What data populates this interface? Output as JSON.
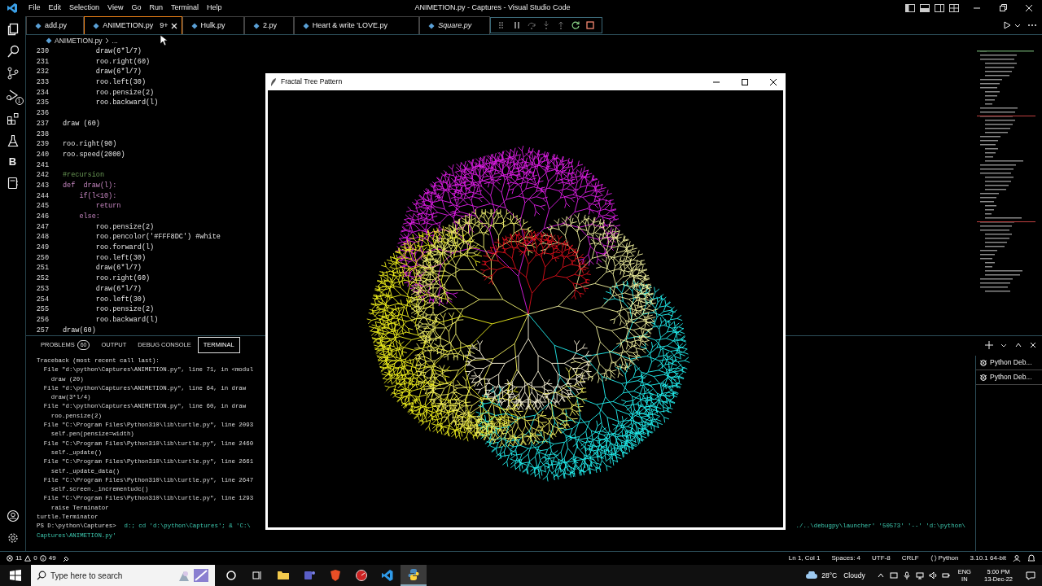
{
  "window": {
    "title": "ANIMETION.py - Captures - Visual Studio Code"
  },
  "menu": [
    "File",
    "Edit",
    "Selection",
    "View",
    "Go",
    "Run",
    "Terminal",
    "Help"
  ],
  "activity_bar": {
    "debug_badge": "1",
    "letter_item": "B"
  },
  "tabs": [
    {
      "label": "add.py",
      "selected": false,
      "preview": false
    },
    {
      "label": "ANIMETION.py",
      "selected": true,
      "preview": false,
      "problems": "9+"
    },
    {
      "label": "Hulk.py",
      "selected": false,
      "preview": false
    },
    {
      "label": "2.py",
      "selected": false,
      "preview": false
    },
    {
      "label": "Heart & write 'LOVE.py",
      "selected": false,
      "preview": false
    },
    {
      "label": "Square.py",
      "selected": false,
      "preview": true
    }
  ],
  "debug_toolbar": [
    {
      "kind": "grip",
      "disabled": false
    },
    {
      "kind": "pause",
      "disabled": false
    },
    {
      "kind": "step-over",
      "disabled": true
    },
    {
      "kind": "step-into",
      "disabled": true
    },
    {
      "kind": "step-out",
      "disabled": true
    },
    {
      "kind": "restart",
      "disabled": false
    },
    {
      "kind": "stop",
      "disabled": false
    }
  ],
  "breadcrumb": [
    "ANIMETION.py",
    "..."
  ],
  "code_lines": [
    {
      "number": "230",
      "kind": "code",
      "text": "        draw(6*l/7)"
    },
    {
      "number": "231",
      "kind": "code",
      "text": "        roo.right(60)"
    },
    {
      "number": "232",
      "kind": "code",
      "text": "        draw(6*l/7)"
    },
    {
      "number": "233",
      "kind": "code",
      "text": "        roo.left(30)"
    },
    {
      "number": "234",
      "kind": "code",
      "text": "        roo.pensize(2)"
    },
    {
      "number": "235",
      "kind": "code",
      "text": "        roo.backward(l)"
    },
    {
      "number": "236",
      "kind": "blank"
    },
    {
      "number": "237",
      "kind": "code",
      "text": "draw (60)"
    },
    {
      "number": "238",
      "kind": "blank"
    },
    {
      "number": "239",
      "kind": "code",
      "text": "roo.right(90)"
    },
    {
      "number": "240",
      "kind": "code",
      "text": "roo.speed(2000)"
    },
    {
      "number": "241",
      "kind": "blank"
    },
    {
      "number": "242",
      "kind": "comment",
      "text": "#recursion"
    },
    {
      "number": "243",
      "kind": "keyword",
      "text": "def  draw(l):"
    },
    {
      "number": "244",
      "kind": "keyword",
      "text": "    if(l<10):"
    },
    {
      "number": "245",
      "kind": "keyword",
      "text": "        return"
    },
    {
      "number": "246",
      "kind": "keyword",
      "text": "    else:"
    },
    {
      "number": "247",
      "kind": "code",
      "text": "        roo.pensize(2)"
    },
    {
      "number": "248",
      "kind": "code",
      "text": "        roo.pencolor('#FFF8DC') #white"
    },
    {
      "number": "249",
      "kind": "code",
      "text": "        roo.forward(l)"
    },
    {
      "number": "250",
      "kind": "code",
      "text": "        roo.left(30)"
    },
    {
      "number": "251",
      "kind": "code",
      "text": "        draw(6*l/7)"
    },
    {
      "number": "252",
      "kind": "code",
      "text": "        roo.right(60)"
    },
    {
      "number": "253",
      "kind": "code",
      "text": "        draw(6*l/7)"
    },
    {
      "number": "254",
      "kind": "code",
      "text": "        roo.left(30)"
    },
    {
      "number": "255",
      "kind": "code",
      "text": "        roo.pensize(2)"
    },
    {
      "number": "256",
      "kind": "code",
      "text": "        roo.backward(l)"
    },
    {
      "number": "257",
      "kind": "code",
      "text": "draw(60)"
    }
  ],
  "panel_tabs": [
    {
      "label": "PROBLEMS",
      "badge": "60",
      "selected": false
    },
    {
      "label": "OUTPUT",
      "selected": false
    },
    {
      "label": "DEBUG CONSOLE",
      "selected": false
    },
    {
      "label": "TERMINAL",
      "selected": true
    }
  ],
  "terminal_lines": [
    {
      "kind": "output",
      "text": "Traceback (most recent call last):"
    },
    {
      "kind": "output",
      "text": "  File \"d:\\python\\Captures\\ANIMETION.py\", line 71, in <modul"
    },
    {
      "kind": "output",
      "text": "    draw (20)"
    },
    {
      "kind": "output",
      "text": "  File \"d:\\python\\Captures\\ANIMETION.py\", line 64, in draw"
    },
    {
      "kind": "output",
      "text": "    draw(3*l/4)"
    },
    {
      "kind": "output",
      "text": "  File \"d:\\python\\Captures\\ANIMETION.py\", line 60, in draw"
    },
    {
      "kind": "output",
      "text": "    roo.pensize(2)"
    },
    {
      "kind": "output",
      "text": "  File \"C:\\Program Files\\Python310\\lib\\turtle.py\", line 2093"
    },
    {
      "kind": "output",
      "text": "    self.pen(pensize=width)"
    },
    {
      "kind": "output",
      "text": "  File \"C:\\Program Files\\Python310\\lib\\turtle.py\", line 2460"
    },
    {
      "kind": "output",
      "text": "    self._update()"
    },
    {
      "kind": "output",
      "text": "  File \"C:\\Program Files\\Python310\\lib\\turtle.py\", line 2661"
    },
    {
      "kind": "output",
      "text": "    self._update_data()"
    },
    {
      "kind": "output",
      "text": "  File \"C:\\Program Files\\Python310\\lib\\turtle.py\", line 2647"
    },
    {
      "kind": "output",
      "text": "    self.screen._incrementudc()"
    },
    {
      "kind": "output",
      "text": "  File \"C:\\Program Files\\Python310\\lib\\turtle.py\", line 1293"
    },
    {
      "kind": "output",
      "text": "    raise Terminator"
    },
    {
      "kind": "output",
      "text": "turtle.Terminator"
    },
    {
      "kind": "prompt",
      "prompt": "PS D:\\python\\Captures>",
      "text": "d:; cd 'd:\\python\\Captures'; & 'C:\\",
      "continuation": "./..\\debugpy\\launcher' '50573' '--' 'd:\\python\\"
    },
    {
      "kind": "command",
      "text": "Captures\\ANIMETION.py'"
    }
  ],
  "terminal_sessions": [
    {
      "label": "Python Deb..."
    },
    {
      "label": "Python Deb..."
    }
  ],
  "status_bar": {
    "errors": "11",
    "warnings": "0",
    "infos": "49",
    "right": [
      "Ln 1, Col 1",
      "Spaces: 4",
      "UTF-8",
      "CRLF",
      "Python",
      "3.10.1 64-bit"
    ]
  },
  "turtle_window": {
    "title": "Fractal Tree Pattern"
  },
  "taskbar": {
    "search_placeholder": "Type here to search",
    "apps": [
      {
        "kind": "folder",
        "selected": false
      },
      {
        "kind": "teams",
        "selected": false
      },
      {
        "kind": "brave",
        "selected": false
      },
      {
        "kind": "gauge",
        "selected": false
      },
      {
        "kind": "vscode",
        "selected": false
      },
      {
        "kind": "python",
        "selected": true
      }
    ],
    "temperature": "28°C",
    "weather": "Cloudy",
    "language": [
      "ENG",
      "IN"
    ],
    "time": "5:00 PM",
    "date": "13-Dec-22"
  }
}
